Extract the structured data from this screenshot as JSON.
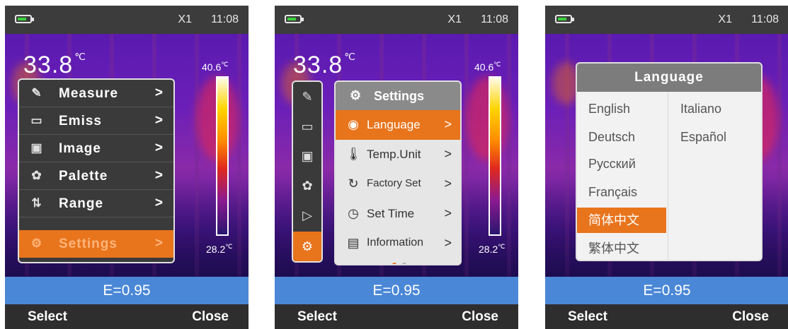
{
  "colors": {
    "accent": "#e8741c",
    "emissivity_bar": "#4a87d6",
    "status_bar": "#3c3c3c",
    "menu_dark": "#3a3a3a",
    "menu_light": "#e6e6e6",
    "battery": "#3bd13b"
  },
  "screens": [
    {
      "status": {
        "zoom": "X1",
        "time": "11:08"
      },
      "max_temp": {
        "value": "33.8",
        "unit": "℃"
      },
      "scale": {
        "max": "40.6",
        "min": "28.2",
        "unit": "℃"
      },
      "emissivity": "E=0.95",
      "softkeys": {
        "left": "Select",
        "right": "Close"
      },
      "menu": {
        "items": [
          {
            "label": "Measure",
            "icon": "measure-icon",
            "arrow": ">"
          },
          {
            "label": "Emiss",
            "icon": "emissivity-icon",
            "arrow": ">"
          },
          {
            "label": "Image",
            "icon": "image-icon",
            "arrow": ">"
          },
          {
            "label": "Palette",
            "icon": "palette-icon",
            "arrow": ">"
          },
          {
            "label": "Range",
            "icon": "range-icon",
            "arrow": ">"
          },
          {
            "label": "Settings",
            "icon": "settings-icon",
            "arrow": ">",
            "active": true
          }
        ]
      }
    },
    {
      "status": {
        "zoom": "X1",
        "time": "11:08"
      },
      "max_temp": {
        "value": "33.8",
        "unit": "℃"
      },
      "scale": {
        "max": "40.6",
        "min": "28.2",
        "unit": "℃"
      },
      "emissivity": "E=0.95",
      "softkeys": {
        "left": "Select",
        "right": "Close"
      },
      "icon_strip": [
        "measure-icon",
        "emissivity-icon",
        "image-icon",
        "palette-icon",
        "video-icon",
        "settings-icon"
      ],
      "submenu": {
        "title": "Settings",
        "items": [
          {
            "label": "Language",
            "icon": "language-icon",
            "arrow": ">",
            "active": true
          },
          {
            "label": "Temp.Unit",
            "icon": "thermometer-icon",
            "arrow": ">"
          },
          {
            "label": "Factory Set",
            "icon": "reset-icon",
            "arrow": ">"
          },
          {
            "label": "Set Time",
            "icon": "clock-icon",
            "arrow": ">"
          },
          {
            "label": "Information",
            "icon": "info-icon",
            "arrow": ">"
          }
        ],
        "page_dots": 2
      }
    },
    {
      "status": {
        "zoom": "X1",
        "time": "11:08"
      },
      "emissivity": "E=0.95",
      "softkeys": {
        "left": "Select",
        "right": "Close"
      },
      "language_dialog": {
        "title": "Language",
        "left_column": [
          "English",
          "Deutsch",
          "Русский",
          "Français",
          "简体中文",
          "繁体中文"
        ],
        "right_column": [
          "Italiano",
          "Español"
        ],
        "selected": "简体中文"
      }
    }
  ]
}
